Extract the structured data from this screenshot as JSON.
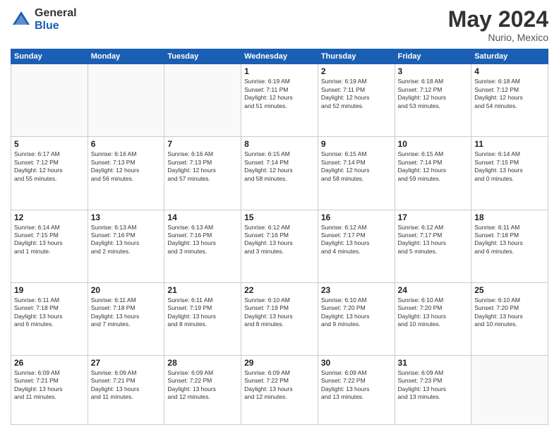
{
  "header": {
    "logo_general": "General",
    "logo_blue": "Blue",
    "month_year": "May 2024",
    "location": "Nurio, Mexico"
  },
  "days_of_week": [
    "Sunday",
    "Monday",
    "Tuesday",
    "Wednesday",
    "Thursday",
    "Friday",
    "Saturday"
  ],
  "weeks": [
    [
      {
        "day": "",
        "info": ""
      },
      {
        "day": "",
        "info": ""
      },
      {
        "day": "",
        "info": ""
      },
      {
        "day": "1",
        "info": "Sunrise: 6:19 AM\nSunset: 7:11 PM\nDaylight: 12 hours\nand 51 minutes."
      },
      {
        "day": "2",
        "info": "Sunrise: 6:19 AM\nSunset: 7:11 PM\nDaylight: 12 hours\nand 52 minutes."
      },
      {
        "day": "3",
        "info": "Sunrise: 6:18 AM\nSunset: 7:12 PM\nDaylight: 12 hours\nand 53 minutes."
      },
      {
        "day": "4",
        "info": "Sunrise: 6:18 AM\nSunset: 7:12 PM\nDaylight: 12 hours\nand 54 minutes."
      }
    ],
    [
      {
        "day": "5",
        "info": "Sunrise: 6:17 AM\nSunset: 7:12 PM\nDaylight: 12 hours\nand 55 minutes."
      },
      {
        "day": "6",
        "info": "Sunrise: 6:16 AM\nSunset: 7:13 PM\nDaylight: 12 hours\nand 56 minutes."
      },
      {
        "day": "7",
        "info": "Sunrise: 6:16 AM\nSunset: 7:13 PM\nDaylight: 12 hours\nand 57 minutes."
      },
      {
        "day": "8",
        "info": "Sunrise: 6:15 AM\nSunset: 7:14 PM\nDaylight: 12 hours\nand 58 minutes."
      },
      {
        "day": "9",
        "info": "Sunrise: 6:15 AM\nSunset: 7:14 PM\nDaylight: 12 hours\nand 58 minutes."
      },
      {
        "day": "10",
        "info": "Sunrise: 6:15 AM\nSunset: 7:14 PM\nDaylight: 12 hours\nand 59 minutes."
      },
      {
        "day": "11",
        "info": "Sunrise: 6:14 AM\nSunset: 7:15 PM\nDaylight: 13 hours\nand 0 minutes."
      }
    ],
    [
      {
        "day": "12",
        "info": "Sunrise: 6:14 AM\nSunset: 7:15 PM\nDaylight: 13 hours\nand 1 minute."
      },
      {
        "day": "13",
        "info": "Sunrise: 6:13 AM\nSunset: 7:16 PM\nDaylight: 13 hours\nand 2 minutes."
      },
      {
        "day": "14",
        "info": "Sunrise: 6:13 AM\nSunset: 7:16 PM\nDaylight: 13 hours\nand 3 minutes."
      },
      {
        "day": "15",
        "info": "Sunrise: 6:12 AM\nSunset: 7:16 PM\nDaylight: 13 hours\nand 3 minutes."
      },
      {
        "day": "16",
        "info": "Sunrise: 6:12 AM\nSunset: 7:17 PM\nDaylight: 13 hours\nand 4 minutes."
      },
      {
        "day": "17",
        "info": "Sunrise: 6:12 AM\nSunset: 7:17 PM\nDaylight: 13 hours\nand 5 minutes."
      },
      {
        "day": "18",
        "info": "Sunrise: 6:11 AM\nSunset: 7:18 PM\nDaylight: 13 hours\nand 6 minutes."
      }
    ],
    [
      {
        "day": "19",
        "info": "Sunrise: 6:11 AM\nSunset: 7:18 PM\nDaylight: 13 hours\nand 6 minutes."
      },
      {
        "day": "20",
        "info": "Sunrise: 6:11 AM\nSunset: 7:18 PM\nDaylight: 13 hours\nand 7 minutes."
      },
      {
        "day": "21",
        "info": "Sunrise: 6:11 AM\nSunset: 7:19 PM\nDaylight: 13 hours\nand 8 minutes."
      },
      {
        "day": "22",
        "info": "Sunrise: 6:10 AM\nSunset: 7:19 PM\nDaylight: 13 hours\nand 8 minutes."
      },
      {
        "day": "23",
        "info": "Sunrise: 6:10 AM\nSunset: 7:20 PM\nDaylight: 13 hours\nand 9 minutes."
      },
      {
        "day": "24",
        "info": "Sunrise: 6:10 AM\nSunset: 7:20 PM\nDaylight: 13 hours\nand 10 minutes."
      },
      {
        "day": "25",
        "info": "Sunrise: 6:10 AM\nSunset: 7:20 PM\nDaylight: 13 hours\nand 10 minutes."
      }
    ],
    [
      {
        "day": "26",
        "info": "Sunrise: 6:09 AM\nSunset: 7:21 PM\nDaylight: 13 hours\nand 11 minutes."
      },
      {
        "day": "27",
        "info": "Sunrise: 6:09 AM\nSunset: 7:21 PM\nDaylight: 13 hours\nand 11 minutes."
      },
      {
        "day": "28",
        "info": "Sunrise: 6:09 AM\nSunset: 7:22 PM\nDaylight: 13 hours\nand 12 minutes."
      },
      {
        "day": "29",
        "info": "Sunrise: 6:09 AM\nSunset: 7:22 PM\nDaylight: 13 hours\nand 12 minutes."
      },
      {
        "day": "30",
        "info": "Sunrise: 6:09 AM\nSunset: 7:22 PM\nDaylight: 13 hours\nand 13 minutes."
      },
      {
        "day": "31",
        "info": "Sunrise: 6:09 AM\nSunset: 7:23 PM\nDaylight: 13 hours\nand 13 minutes."
      },
      {
        "day": "",
        "info": ""
      }
    ]
  ]
}
